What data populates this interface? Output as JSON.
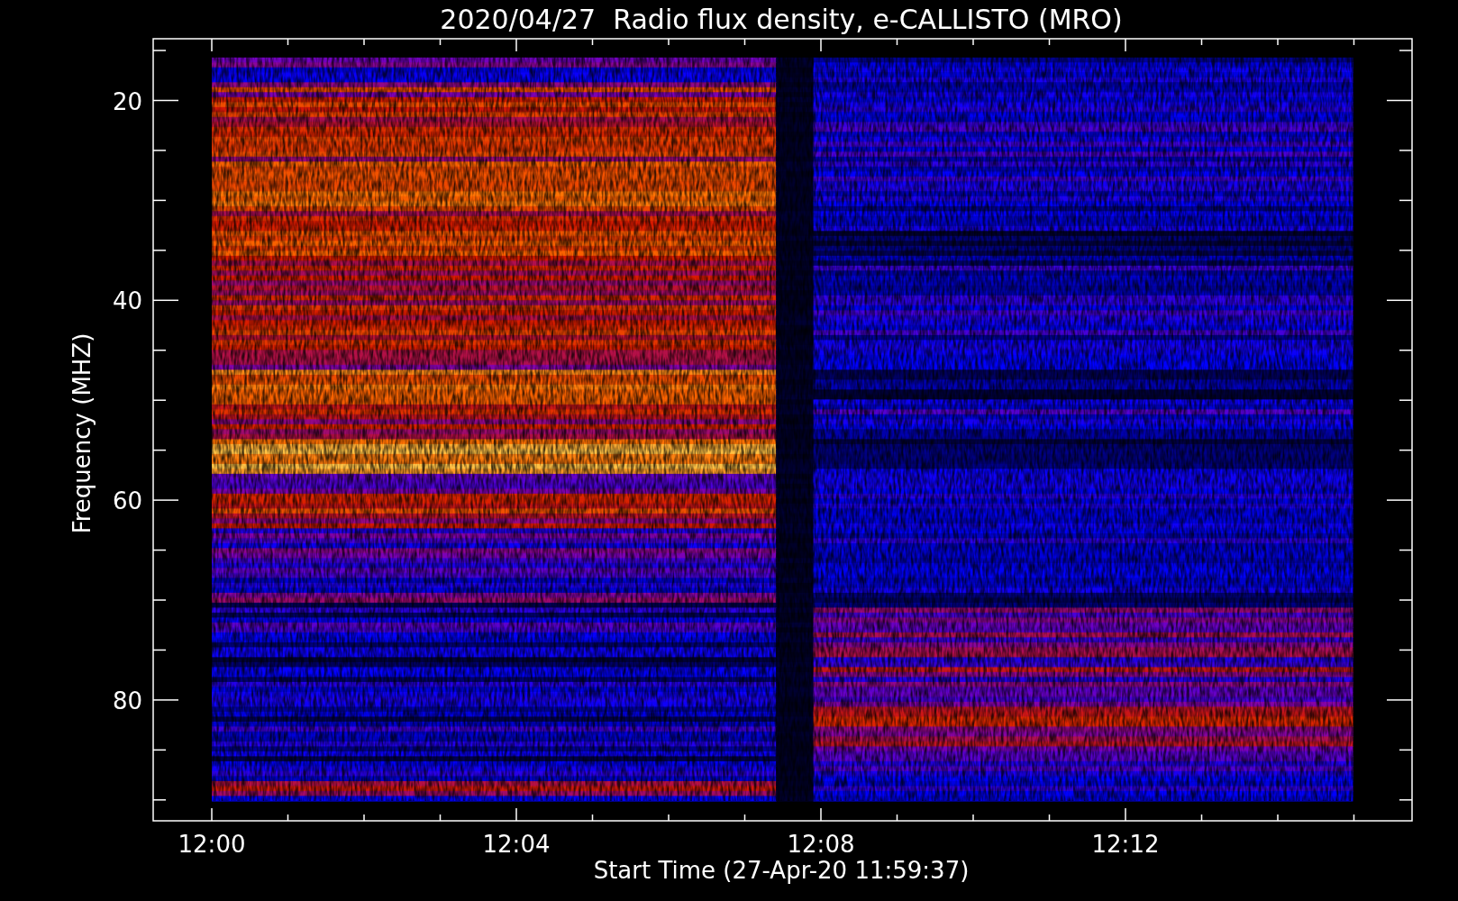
{
  "title": "2020/04/27  Radio flux density, e-CALLISTO (MRO)",
  "y_axis": {
    "label": "Frequency (MHZ)",
    "ticks": [
      "20",
      "40",
      "60",
      "80"
    ]
  },
  "x_axis": {
    "label": "Start Time (27-Apr-20 11:59:37)",
    "ticks": [
      "12:00",
      "12:04",
      "12:08",
      "12:12"
    ]
  }
}
